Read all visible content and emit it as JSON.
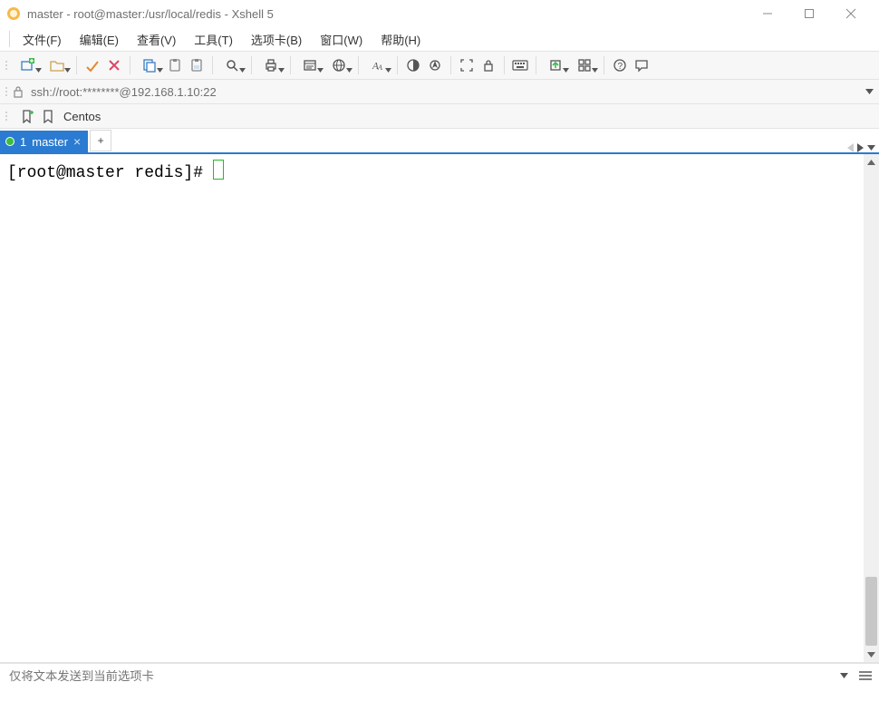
{
  "title": "master - root@master:/usr/local/redis - Xshell 5",
  "menu": {
    "file": "文件(F)",
    "edit": "编辑(E)",
    "view": "查看(V)",
    "tools": "工具(T)",
    "tabs": "选项卡(B)",
    "window": "窗口(W)",
    "help": "帮助(H)"
  },
  "address": "ssh://root:********@192.168.1.10:22",
  "bookmark": "Centos",
  "tabs": {
    "active": {
      "index": "1",
      "label": "master"
    }
  },
  "terminal": {
    "prompt": "[root@master redis]# "
  },
  "compose_placeholder": "仅将文本发送到当前选项卡"
}
